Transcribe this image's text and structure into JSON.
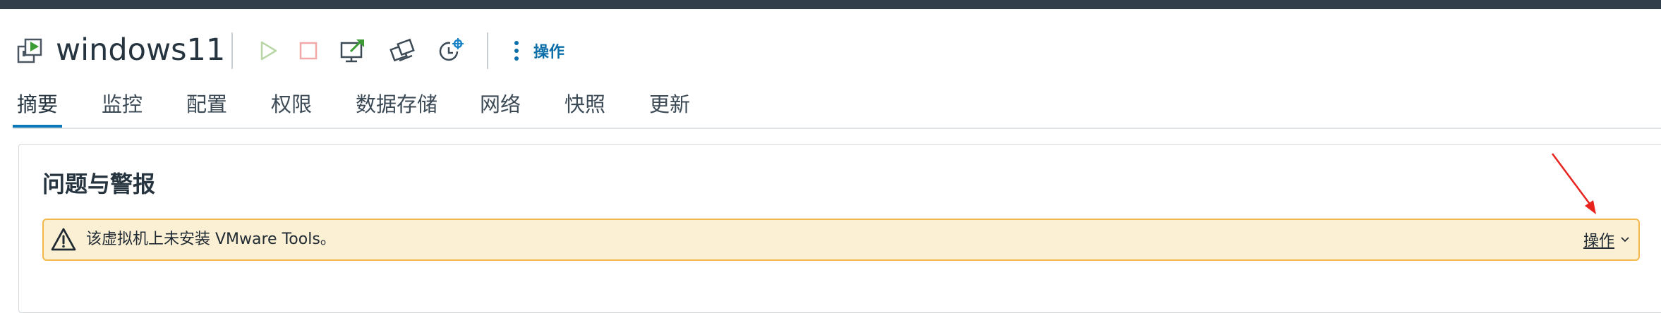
{
  "header": {
    "vm_name": "windows11",
    "actions_label": "操作",
    "toolbar_icons": [
      "vm-icon",
      "power-on-icon",
      "power-off-icon",
      "launch-console-icon",
      "migrate-icon",
      "snapshot-icon",
      "more-vertical-icon"
    ]
  },
  "tabs": [
    {
      "label": "摘要",
      "active": true
    },
    {
      "label": "监控",
      "active": false
    },
    {
      "label": "配置",
      "active": false
    },
    {
      "label": "权限",
      "active": false
    },
    {
      "label": "数据存储",
      "active": false
    },
    {
      "label": "网络",
      "active": false
    },
    {
      "label": "快照",
      "active": false
    },
    {
      "label": "更新",
      "active": false
    }
  ],
  "card": {
    "title": "问题与警报",
    "alert": {
      "message": "该虚拟机上未安装 VMware Tools。",
      "action_label": "操作",
      "icon": "warning-triangle-icon"
    }
  },
  "colors": {
    "topbar": "#2f3e4a",
    "accent": "#0b78b8",
    "alert_bg": "#fcf0d4",
    "alert_border": "#f2b84d",
    "annotation_arrow": "#e8231e"
  }
}
